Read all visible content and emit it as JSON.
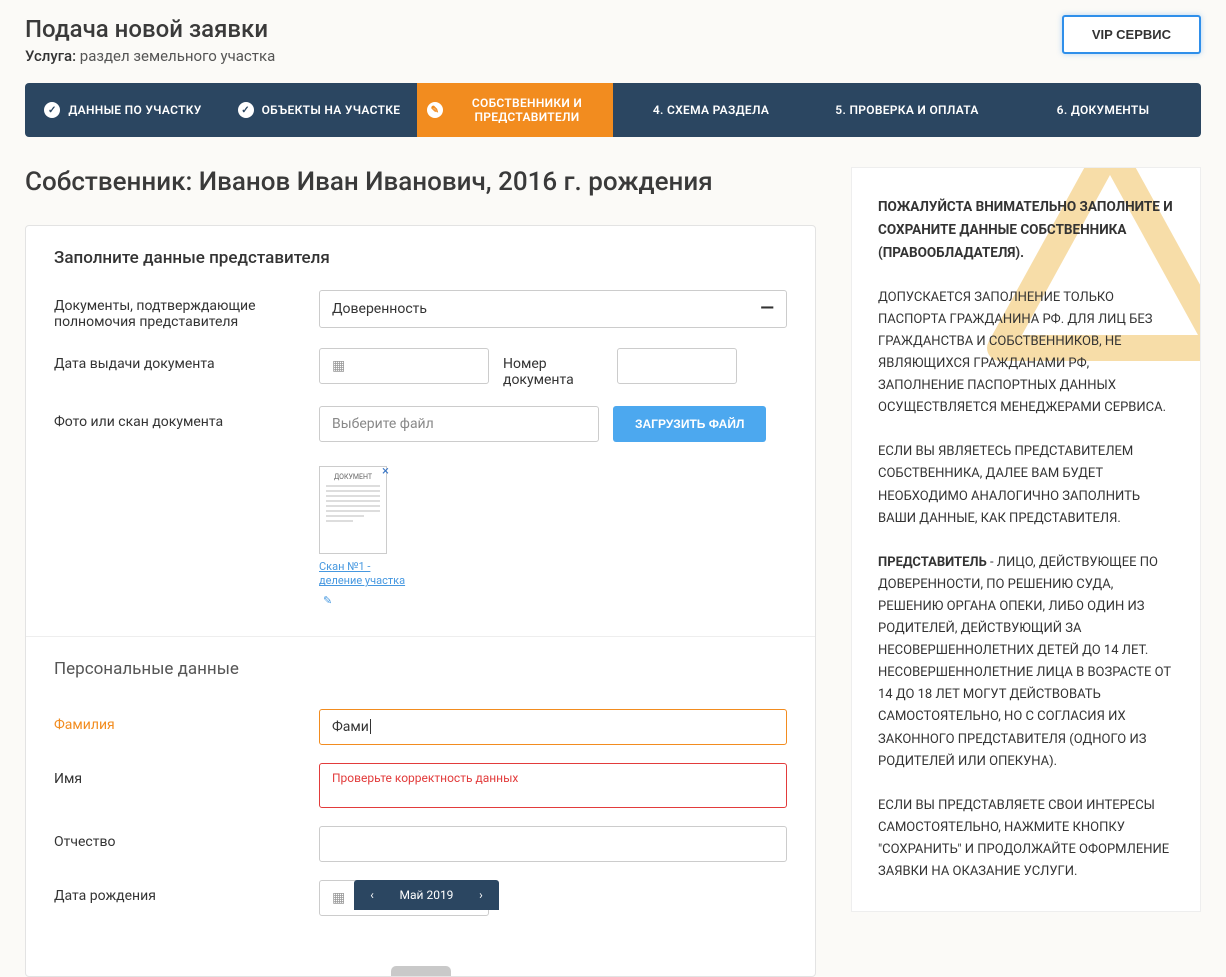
{
  "header": {
    "title": "Подача новой заявки",
    "subtitle_label": "Услуга:",
    "subtitle_value": "раздел земельного участка",
    "vip_button": "VIP СЕРВИС"
  },
  "steps": [
    {
      "label": "ДАННЫЕ ПО УЧАСТКУ",
      "icon": "check"
    },
    {
      "label": "ОБЪЕКТЫ НА УЧАСТКЕ",
      "icon": "check"
    },
    {
      "label": "СОБСТВЕННИКИ И ПРЕДСТАВИТЕЛИ",
      "icon": "edit",
      "active": true
    },
    {
      "label": "4. СХЕМА РАЗДЕЛА"
    },
    {
      "label": "5. ПРОВЕРКА И ОПЛАТА"
    },
    {
      "label": "6. ДОКУМЕНТЫ"
    }
  ],
  "owner_title": "Собственник: Иванов Иван Иванович, 2016 г. рождения",
  "rep_section": {
    "title": "Заполните данные представителя",
    "doc_label": "Документы, подтверждающие полномочия представителя",
    "doc_value": "Доверенность",
    "issue_date_label": "Дата выдачи документа",
    "doc_number_label": "Номер документа",
    "scan_label": "Фото или скан документа",
    "file_placeholder": "Выберите файл",
    "upload_button": "ЗАГРУЗИТЬ ФАЙЛ",
    "thumb_caption": "Скан №1 - деление участка"
  },
  "personal_section": {
    "title": "Персональные данные",
    "surname_label": "Фамилия",
    "surname_value": "Фами",
    "name_label": "Имя",
    "name_error": "Проверьте корректность данных",
    "patronymic_label": "Отчество",
    "dob_label": "Дата рождения",
    "dob_month": "Май 2019"
  },
  "sidebar": {
    "p1": "ПОЖАЛУЙСТА ВНИМАТЕЛЬНО  ЗАПОЛНИТЕ И СОХРАНИТЕ ДАННЫЕ СОБСТВЕННИКА (ПРАВООБЛАДАТЕЛЯ).",
    "p2": "ДОПУСКАЕТСЯ ЗАПОЛНЕНИЕ  ТОЛЬКО ПАСПОРТА ГРАЖДАНИНА РФ. ДЛЯ ЛИЦ БЕЗ ГРАЖДАНСТВА И СОБСТВЕННИКОВ, НЕ ЯВЛЯЮЩИХСЯ ГРАЖДАНАМИ РФ,  ЗАПОЛНЕНИЕ ПАСПОРТНЫХ ДАННЫХ ОСУЩЕСТВЛЯЕТСЯ МЕНЕДЖЕРАМИ СЕРВИСА.",
    "p3": "ЕСЛИ ВЫ  ЯВЛЯЕТЕСЬ ПРЕДСТАВИТЕЛЕМ СОБСТВЕННИКА,  ДАЛЕЕ ВАМ БУДЕТ НЕОБХОДИМО  АНАЛОГИЧНО  ЗАПОЛНИТЬ  ВАШИ  ДАННЫЕ, КАК  ПРЕДСТАВИТЕЛЯ.",
    "p4_b": "ПРЕДСТАВИТЕЛЬ",
    "p4": " - ЛИЦО, ДЕЙСТВУЮЩЕЕ ПО ДОВЕРЕННОСТИ, ПО РЕШЕНИЮ СУДА, РЕШЕНИЮ ОРГАНА ОПЕКИ,  ЛИБО ОДИН ИЗ РОДИТЕЛЕЙ, ДЕЙСТВУЮЩИЙ   ЗА НЕСОВЕРШЕННОЛЕТНИХ ДЕТЕЙ  ДО 14 ЛЕТ.   НЕСОВЕРШЕННОЛЕТНИЕ ЛИЦА В ВОЗРАСТЕ ОТ 14 ДО 18 ЛЕТ МОГУТ ДЕЙСТВОВАТЬ САМОСТОЯТЕЛЬНО,  НО С СОГЛАСИЯ ИХ ЗАКОННОГО ПРЕДСТАВИТЕЛЯ (ОДНОГО ИЗ РОДИТЕЛЕЙ ИЛИ ОПЕКУНА).",
    "p5": "ЕСЛИ ВЫ ПРЕДСТАВЛЯЕТЕ СВОИ ИНТЕРЕСЫ САМОСТОЯТЕЛЬНО, НАЖМИТЕ КНОПКУ \"СОХРАНИТЬ\" И ПРОДОЛЖАЙТЕ ОФОРМЛЕНИЕ ЗАЯВКИ НА ОКАЗАНИЕ УСЛУГИ."
  }
}
